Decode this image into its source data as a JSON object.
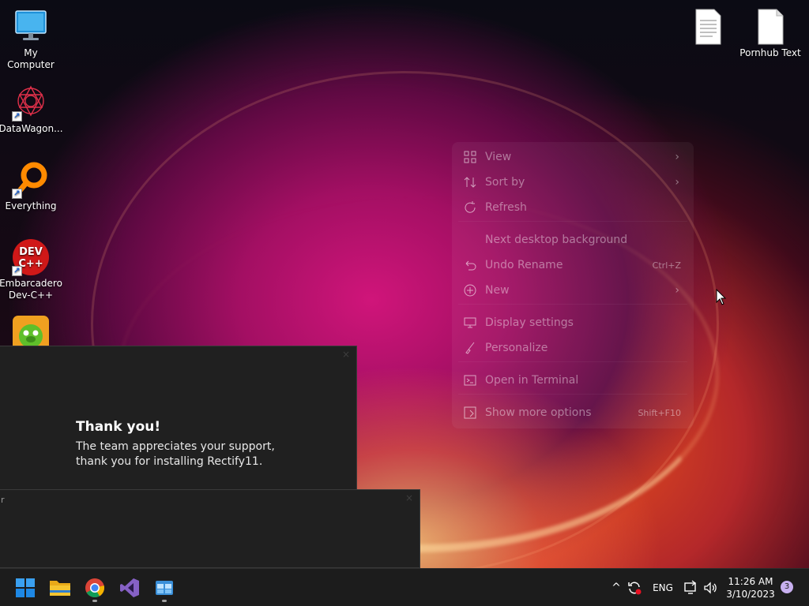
{
  "desktop": {
    "icons_left": [
      {
        "label": "My Computer",
        "icon": "monitor-icon"
      },
      {
        "label": "DataWagon...",
        "icon": "datawagon-icon"
      },
      {
        "label": "Everything",
        "icon": "magnifier-icon"
      },
      {
        "label": "Embarcadero Dev-C++",
        "icon": "devcpp-icon"
      },
      {
        "label": "",
        "icon": "game-icon"
      }
    ],
    "icons_right": [
      {
        "label": "",
        "icon": "text-document-icon"
      },
      {
        "label": "Pornhub Text",
        "icon": "blank-document-icon"
      }
    ],
    "shortcut_arrow": "↗"
  },
  "context_menu": {
    "items": [
      {
        "label": "View",
        "icon": "grid-icon",
        "has_submenu": true,
        "shortcut": ""
      },
      {
        "label": "Sort by",
        "icon": "sort-icon",
        "has_submenu": true,
        "shortcut": ""
      },
      {
        "label": "Refresh",
        "icon": "refresh-icon",
        "has_submenu": false,
        "shortcut": ""
      },
      {
        "label": "Next desktop background",
        "icon": "",
        "has_submenu": false,
        "shortcut": ""
      },
      {
        "label": "Undo Rename",
        "icon": "undo-icon",
        "has_submenu": false,
        "shortcut": "Ctrl+Z"
      },
      {
        "label": "New",
        "icon": "plus-circle-icon",
        "has_submenu": true,
        "shortcut": ""
      },
      {
        "label": "Display settings",
        "icon": "display-icon",
        "has_submenu": false,
        "shortcut": ""
      },
      {
        "label": "Personalize",
        "icon": "brush-icon",
        "has_submenu": false,
        "shortcut": ""
      },
      {
        "label": "Open in Terminal",
        "icon": "terminal-icon",
        "has_submenu": false,
        "shortcut": ""
      },
      {
        "label": "Show more options",
        "icon": "more-options-icon",
        "has_submenu": false,
        "shortcut": "Shift+F10"
      }
    ],
    "submenu_arrow": "›"
  },
  "dialog_thanks": {
    "title": "Thank you!",
    "body": "The team appreciates your support, thank you for installing Rectify11.",
    "close": "×"
  },
  "dialog_second": {
    "left_char": "r",
    "close": "×"
  },
  "taskbar": {
    "apps": [
      {
        "name": "start-button",
        "icon": "windows-logo-icon",
        "running": false
      },
      {
        "name": "file-explorer-button",
        "icon": "folder-icon",
        "running": false
      },
      {
        "name": "chrome-button",
        "icon": "chrome-icon",
        "running": true
      },
      {
        "name": "visual-studio-button",
        "icon": "visual-studio-icon",
        "running": false
      },
      {
        "name": "rectify-installer-button",
        "icon": "installer-icon",
        "running": true
      }
    ],
    "tray": {
      "chevron": "^",
      "language": "ENG",
      "time": "11:26 AM",
      "date": "3/10/2023",
      "notification_count": "3"
    },
    "colors": {
      "accent": "#0078d4",
      "folder": "#f4c430"
    }
  }
}
